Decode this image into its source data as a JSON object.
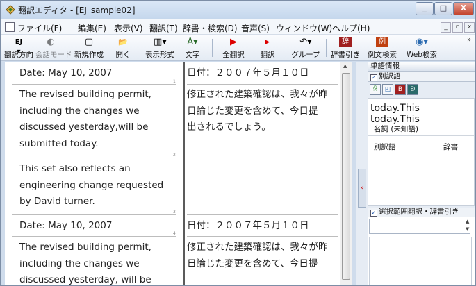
{
  "window": {
    "title": "翻訳エディタ - [EJ_sample02]",
    "buttons": {
      "minimize": "_",
      "maximize": "□",
      "close": "X"
    }
  },
  "menu": [
    "ファイル(F)",
    "編集(E)",
    "表示(V)",
    "翻訳(T)",
    "辞書・検索(D)",
    "音声(S)",
    "ウィンドウ(W)",
    "ヘルプ(H)"
  ],
  "mdi": {
    "minimize": "_",
    "restore": "▫",
    "close": "x"
  },
  "toolbar": {
    "items": [
      {
        "label": "翻訳方向",
        "icon": "EJ ▾"
      },
      {
        "label": "会話モード",
        "icon": "◐"
      },
      {
        "label": "新規作成",
        "icon": "▢"
      },
      {
        "label": "開く",
        "icon": "📂"
      },
      {
        "label": "表示形式",
        "icon": "▥▾"
      },
      {
        "label": "文字",
        "icon": "A▾"
      },
      {
        "label": "全翻訳",
        "icon": "▶"
      },
      {
        "label": "翻訳",
        "icon": "▸"
      },
      {
        "label": "グループ",
        "icon": "↶▾"
      },
      {
        "label": "辞書引き",
        "icon": "辞"
      },
      {
        "label": "例文検索",
        "icon": "例"
      },
      {
        "label": "Web検索",
        "icon": "◉▾"
      }
    ],
    "overflow": "»"
  },
  "editor": {
    "left": [
      "Date: May 10, 2007",
      [
        "The revised building permit,",
        "including the changes we",
        "discussed yesterday,will be",
        "submitted today."
      ],
      [
        "This set also reflects an",
        "engineering change requested",
        "by David turner."
      ],
      "Date: May 10, 2007",
      [
        "The revised building permit,",
        "including the changes we",
        "discussed yesterday, will be"
      ]
    ],
    "right": [
      "日付：２００７年５月１０日",
      [
        "修正された建築確認は、我々が昨",
        "日論じた変更を含めて、今日提",
        "出されるでしょう。"
      ],
      "日付：２００７年５月１０日",
      [
        "修正された建築確認は、我々が昨",
        "日論じた変更を含めて、今日提"
      ]
    ],
    "segnums": [
      "1",
      "2",
      "3",
      "4"
    ]
  },
  "panel": {
    "section_title": "単語情報",
    "alt_word_checkbox": "別訳語",
    "word_lines": [
      "today.This",
      "today.This"
    ],
    "pos_line": "名詞  (未知語)",
    "col_headers": {
      "alt": "別訳語",
      "dict": "辞書"
    },
    "selection_checkbox": "選択範囲翻訳・辞書引き",
    "collapse_arrow": "»"
  },
  "colors": {
    "title_bg": "#c4d6ec",
    "close_btn": "#c2432d",
    "accent_red": "#cc0000"
  }
}
